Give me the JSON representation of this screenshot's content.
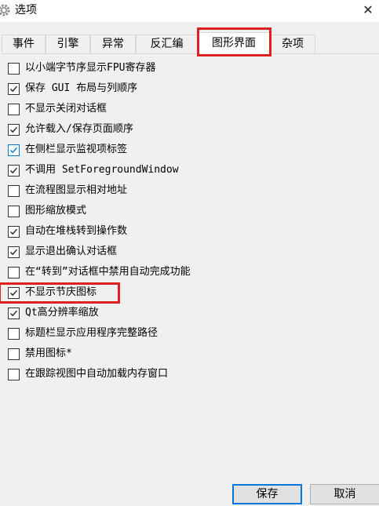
{
  "window": {
    "title": "选项",
    "close_glyph": "✕",
    "icon": "gear-icon"
  },
  "tabs": [
    "事件",
    "引擎",
    "异常",
    "反汇编",
    "图形界面",
    "杂项"
  ],
  "active_tab": "图形界面",
  "options": [
    {
      "label": "以小端字节序显示FPU寄存器",
      "checked": false
    },
    {
      "label": "保存 GUI 布局与列顺序",
      "checked": true
    },
    {
      "label": "不显示关闭对话框",
      "checked": false
    },
    {
      "label": "允许载入/保存页面顺序",
      "checked": true
    },
    {
      "label": "在侧栏显示监视项标签",
      "checked": true
    },
    {
      "label": "不调用 SetForegroundWindow",
      "checked": true
    },
    {
      "label": "在流程图显示相对地址",
      "checked": false
    },
    {
      "label": "图形缩放模式",
      "checked": false
    },
    {
      "label": "自动在堆栈转到操作数",
      "checked": true
    },
    {
      "label": "显示退出确认对话框",
      "checked": true
    },
    {
      "label": "在“转到”对话框中禁用自动完成功能",
      "checked": false
    },
    {
      "label": "不显示节庆图标",
      "checked": true
    },
    {
      "label": "Qt高分辨率缩放",
      "checked": true
    },
    {
      "label": "标题栏显示应用程序完整路径",
      "checked": false
    },
    {
      "label": "禁用图标*",
      "checked": false
    },
    {
      "label": "在跟踪视图中自动加载内存窗口",
      "checked": false
    }
  ],
  "buttons": {
    "save": "保存",
    "cancel": "取消"
  },
  "colors": {
    "highlight": "#e02020",
    "focus": "#0078d7",
    "check_focused": "#0078d7"
  }
}
